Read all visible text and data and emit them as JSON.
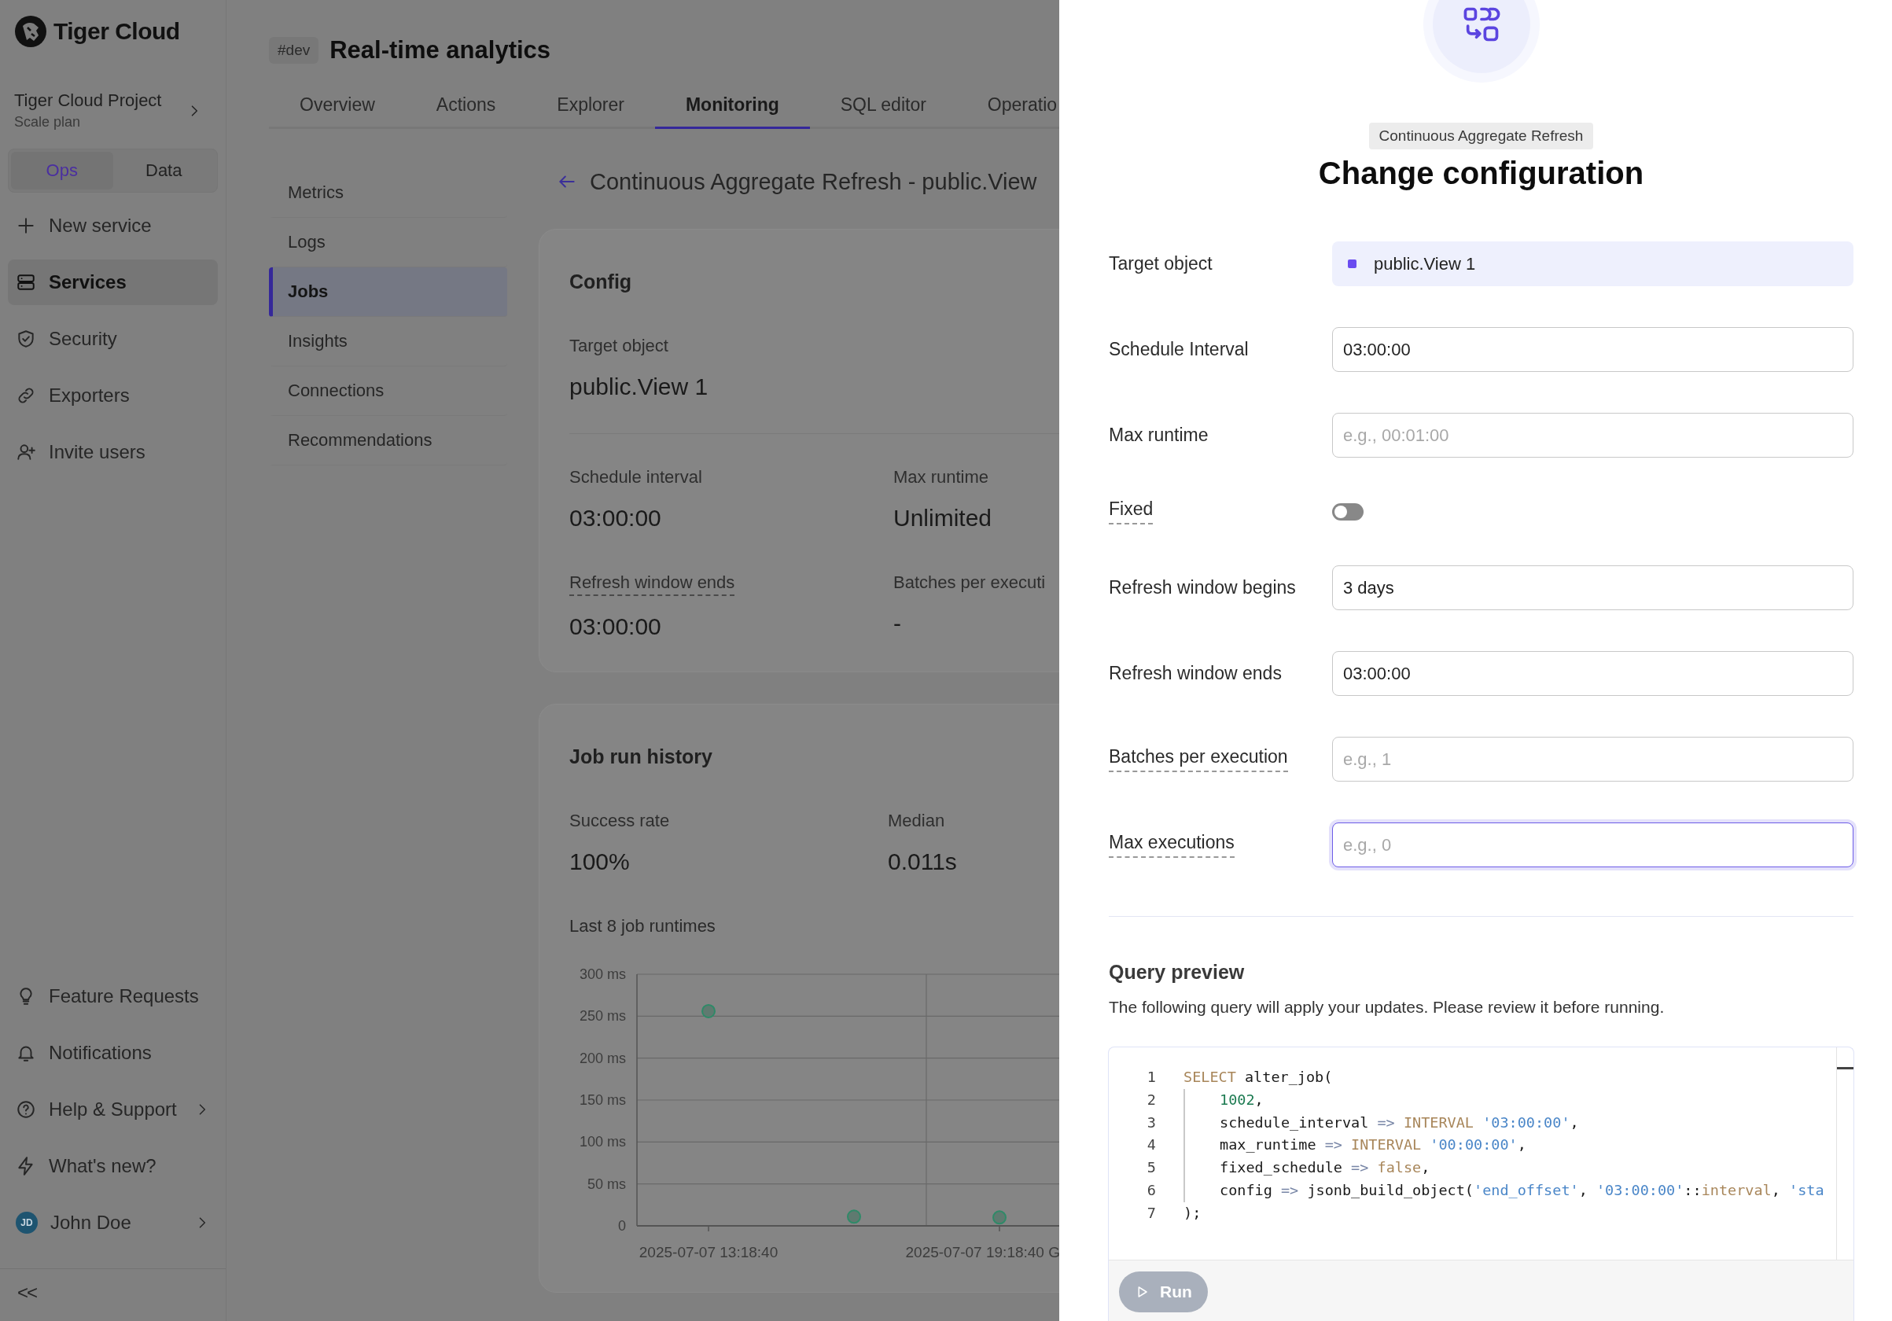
{
  "sidebar": {
    "brand": "Tiger Cloud",
    "project": {
      "name": "Tiger Cloud Project",
      "plan": "Scale plan"
    },
    "segments": [
      {
        "label": "Ops",
        "selected": true
      },
      {
        "label": "Data",
        "selected": false
      }
    ],
    "items": [
      {
        "label": "New service",
        "selected": false
      },
      {
        "label": "Services",
        "selected": true
      },
      {
        "label": "Security",
        "selected": false
      },
      {
        "label": "Exporters",
        "selected": false
      },
      {
        "label": "Invite users",
        "selected": false
      }
    ],
    "footer_items": [
      {
        "label": "Feature Requests",
        "chevron": false
      },
      {
        "label": "Notifications",
        "chevron": false
      },
      {
        "label": "Help & Support",
        "chevron": true
      },
      {
        "label": "What's new?",
        "chevron": false
      },
      {
        "label": "John Doe",
        "initials": "JD",
        "chevron": true
      }
    ],
    "collapse": "<<"
  },
  "header": {
    "env": "#dev",
    "title": "Real-time analytics"
  },
  "tabs": [
    {
      "label": "Overview",
      "selected": false
    },
    {
      "label": "Actions",
      "selected": false
    },
    {
      "label": "Explorer",
      "selected": false
    },
    {
      "label": "Monitoring",
      "selected": true
    },
    {
      "label": "SQL editor",
      "selected": false
    },
    {
      "label": "Operatio",
      "selected": false
    }
  ],
  "subnav": [
    {
      "label": "Metrics",
      "selected": false
    },
    {
      "label": "Logs",
      "selected": false
    },
    {
      "label": "Jobs",
      "selected": true
    },
    {
      "label": "Insights",
      "selected": false
    },
    {
      "label": "Connections",
      "selected": false
    },
    {
      "label": "Recommendations",
      "selected": false
    }
  ],
  "job_title": "Continuous Aggregate Refresh - public.View",
  "config": {
    "title": "Config",
    "target_label": "Target object",
    "target_value": "public.View 1",
    "fields": [
      {
        "label": "Schedule interval",
        "value": "03:00:00",
        "has_tooltip": false
      },
      {
        "label": "Max runtime",
        "value": "Unlimited",
        "has_tooltip": false
      },
      {
        "label": "Refresh window ends",
        "value": "03:00:00",
        "has_tooltip": true
      },
      {
        "label": "Batches per executi",
        "value": "-",
        "has_tooltip": false
      }
    ]
  },
  "history": {
    "title": "Job run history",
    "stats": [
      {
        "label": "Success rate",
        "value": "100%"
      },
      {
        "label": "Median",
        "value": "0.011s"
      }
    ],
    "chart_title": "Last 8 job runtimes",
    "chart_data": {
      "type": "scatter",
      "grid": true,
      "categories": [
        "2025-07-07 13:18:40",
        null,
        "2025-07-07 19:18:40 G"
      ],
      "ylim": [
        0,
        300
      ],
      "yticks": [
        {
          "value": 0,
          "label": "0"
        },
        {
          "value": 50,
          "label": "50 ms"
        },
        {
          "value": 100,
          "label": "100 ms"
        },
        {
          "value": 150,
          "label": "150 ms"
        },
        {
          "value": 200,
          "label": "200 ms"
        },
        {
          "value": 250,
          "label": "250 ms"
        },
        {
          "value": 300,
          "label": "300 ms"
        }
      ],
      "series": [
        {
          "color": "#2f8a68",
          "values": [
            256,
            11,
            10
          ]
        }
      ]
    }
  },
  "panel": {
    "tag": "Continuous Aggregate Refresh",
    "title": "Change configuration",
    "rows": [
      {
        "kind": "target",
        "label": "Target object",
        "value": "public.View 1",
        "has_tooltip": false
      },
      {
        "kind": "input",
        "label": "Schedule Interval",
        "value": "03:00:00",
        "has_tooltip": false,
        "focused": false
      },
      {
        "kind": "input",
        "label": "Max runtime",
        "placeholder": "e.g., 00:01:00",
        "has_tooltip": false,
        "focused": false
      },
      {
        "kind": "toggle",
        "label": "Fixed",
        "on": false,
        "has_tooltip": true
      },
      {
        "kind": "input",
        "label": "Refresh window begins",
        "value": "3 days",
        "has_tooltip": false,
        "focused": false
      },
      {
        "kind": "input",
        "label": "Refresh window ends",
        "value": "03:00:00",
        "has_tooltip": false,
        "focused": false
      },
      {
        "kind": "input",
        "label": "Batches per execution",
        "placeholder": "e.g., 1",
        "has_tooltip": true,
        "focused": false
      },
      {
        "kind": "input",
        "label": "Max executions",
        "placeholder": "e.g., 0",
        "has_tooltip": true,
        "focused": true
      }
    ],
    "query": {
      "title": "Query preview",
      "description": "The following query will apply your updates. Please review it before running.",
      "lines": [
        {
          "number": "1",
          "indent": false,
          "tokens": [
            {
              "text": "SELECT",
              "kind": "keyword"
            },
            {
              "text": " alter_job(",
              "kind": "plain"
            }
          ]
        },
        {
          "number": "2",
          "indent": true,
          "tokens": [
            {
              "text": "1002",
              "kind": "number"
            },
            {
              "text": ",",
              "kind": "plain"
            }
          ]
        },
        {
          "number": "3",
          "indent": true,
          "tokens": [
            {
              "text": "schedule_interval ",
              "kind": "plain"
            },
            {
              "text": "=>",
              "kind": "operator"
            },
            {
              "text": " INTERVAL ",
              "kind": "keyword"
            },
            {
              "text": "'03:00:00'",
              "kind": "string"
            },
            {
              "text": ",",
              "kind": "plain"
            }
          ]
        },
        {
          "number": "4",
          "indent": true,
          "tokens": [
            {
              "text": "max_runtime ",
              "kind": "plain"
            },
            {
              "text": "=>",
              "kind": "operator"
            },
            {
              "text": " INTERVAL ",
              "kind": "keyword"
            },
            {
              "text": "'00:00:00'",
              "kind": "string"
            },
            {
              "text": ",",
              "kind": "plain"
            }
          ]
        },
        {
          "number": "5",
          "indent": true,
          "tokens": [
            {
              "text": "fixed_schedule ",
              "kind": "plain"
            },
            {
              "text": "=>",
              "kind": "operator"
            },
            {
              "text": " false",
              "kind": "keyword"
            },
            {
              "text": ",",
              "kind": "plain"
            }
          ]
        },
        {
          "number": "6",
          "indent": true,
          "tokens": [
            {
              "text": "config ",
              "kind": "plain"
            },
            {
              "text": "=>",
              "kind": "operator"
            },
            {
              "text": " jsonb_build_object(",
              "kind": "plain"
            },
            {
              "text": "'end_offset'",
              "kind": "string"
            },
            {
              "text": ", ",
              "kind": "plain"
            },
            {
              "text": "'03:00:00'",
              "kind": "string"
            },
            {
              "text": "::",
              "kind": "plain"
            },
            {
              "text": "interval",
              "kind": "keyword"
            },
            {
              "text": ", ",
              "kind": "plain"
            },
            {
              "text": "'sta",
              "kind": "string"
            }
          ]
        },
        {
          "number": "7",
          "indent": false,
          "tokens": [
            {
              "text": ");",
              "kind": "plain"
            }
          ]
        }
      ],
      "run_label": "Run",
      "run_disabled": true
    }
  }
}
